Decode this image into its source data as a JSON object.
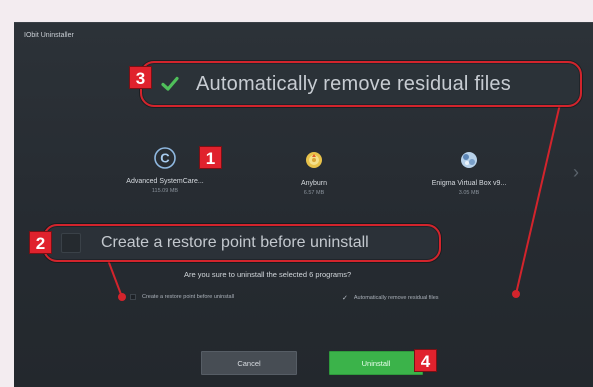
{
  "window": {
    "title": "IObit Uninstaller"
  },
  "callouts": {
    "residual": {
      "badge": "3",
      "label": "Automatically remove residual files",
      "checked": true
    },
    "restore": {
      "badge": "2",
      "label": "Create a restore point before uninstall",
      "checked": false
    },
    "programs_badge": "1",
    "uninstall_badge": "4"
  },
  "programs": [
    {
      "name": "Advanced SystemCare...",
      "size": "115.09 MB",
      "icon": "advanced-systemcare-icon"
    },
    {
      "name": "Anyburn",
      "size": "6.57 MB",
      "icon": "anyburn-disc-icon"
    },
    {
      "name": "Enigma Virtual Box v9...",
      "size": "3.05 MB",
      "icon": "enigma-virtual-box-icon"
    }
  ],
  "prompt": {
    "question": "Are you sure to uninstall the selected 6 programs?",
    "option_restore": "Create a restore point before uninstall",
    "option_residual": "Automatically remove residual files"
  },
  "buttons": {
    "cancel": "Cancel",
    "uninstall": "Uninstall"
  },
  "colors": {
    "accent_red": "#d3242c",
    "badge_red": "#e0222d",
    "uninstall_green": "#3bb34a",
    "check_green": "#4fbf5a",
    "dialog_bg": "#2a2f35"
  }
}
